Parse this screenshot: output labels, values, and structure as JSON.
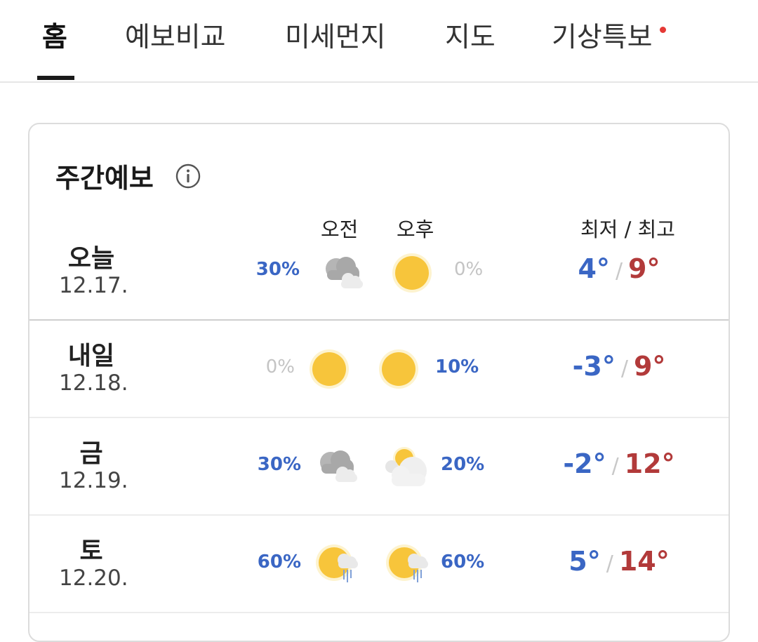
{
  "tabs": [
    {
      "label": "홈",
      "active": true
    },
    {
      "label": "예보비교"
    },
    {
      "label": "미세먼지"
    },
    {
      "label": "지도"
    },
    {
      "label": "기상특보",
      "has_alert_dot": true
    }
  ],
  "weekly": {
    "title": "주간예보",
    "info_icon": "info-circle-icon",
    "am_label": "오전",
    "pm_label": "오후",
    "temp_header": "최저 / 최고",
    "days": [
      {
        "day": "오늘",
        "date": "12.17.",
        "am_pct": "30%",
        "am_icon": "cloudy-icon",
        "pm_icon": "sunny-icon",
        "pm_pct": "0%",
        "min": "4°",
        "max": "9°"
      },
      {
        "day": "내일",
        "date": "12.18.",
        "am_pct": "0%",
        "am_icon": "sunny-icon",
        "pm_icon": "sunny-icon",
        "pm_pct": "10%",
        "min": "-3°",
        "max": "9°"
      },
      {
        "day": "금",
        "date": "12.19.",
        "am_pct": "30%",
        "am_icon": "cloudy-icon",
        "pm_icon": "partly-cloudy-icon",
        "pm_pct": "20%",
        "min": "-2°",
        "max": "12°"
      },
      {
        "day": "토",
        "date": "12.20.",
        "am_pct": "60%",
        "am_icon": "sun-shower-icon",
        "pm_icon": "sun-shower-icon",
        "pm_pct": "60%",
        "min": "5°",
        "max": "14°"
      }
    ]
  },
  "colors": {
    "precip_blue": "#3a66c4",
    "temp_min_blue": "#3a66c4",
    "temp_max_red": "#b23a3a",
    "sun_yellow": "#f7c53b",
    "alert_red": "#e53935"
  }
}
